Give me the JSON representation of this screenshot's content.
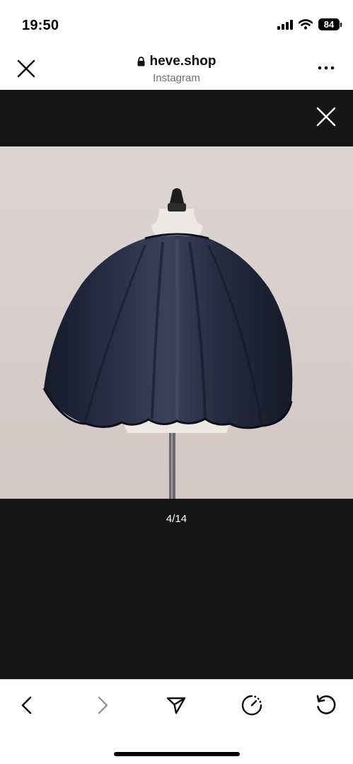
{
  "status_bar": {
    "time": "19:50",
    "battery": "84"
  },
  "browser_header": {
    "domain": "heve.shop",
    "subtitle": "Instagram"
  },
  "viewer": {
    "counter": "4/14",
    "photo_icon": "jacket-on-mannequin-photo"
  },
  "toolbar": {
    "icons": [
      "back-icon",
      "forward-icon",
      "share-icon",
      "speed-icon",
      "reload-icon"
    ]
  },
  "colors": {
    "viewer_bg": "#161616",
    "photo_bg": "#dcd3d3",
    "jacket": "#1f2537",
    "forward_disabled": "#9a9a9a"
  }
}
